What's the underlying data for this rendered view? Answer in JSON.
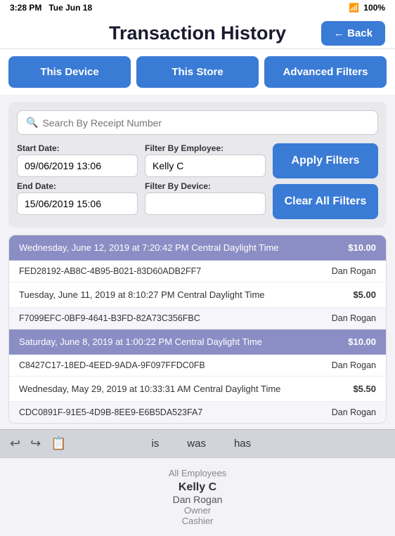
{
  "statusBar": {
    "time": "3:28 PM",
    "date": "Tue Jun 18",
    "wifi": "100%",
    "battery": "100%"
  },
  "header": {
    "backLabel": "← Back",
    "title": "Transaction History"
  },
  "tabs": [
    {
      "id": "this-device",
      "label": "This Device"
    },
    {
      "id": "this-store",
      "label": "This Store"
    },
    {
      "id": "advanced-filters",
      "label": "Advanced Filters"
    }
  ],
  "filters": {
    "searchPlaceholder": "Search By Receipt Number",
    "startDateLabel": "Start Date:",
    "startDateValue": "09/06/2019 13:06",
    "endDateLabel": "End Date:",
    "endDateValue": "15/06/2019 15:06",
    "filterByEmployeeLabel": "Filter By Employee:",
    "filterByEmployeeValue": "Kelly C",
    "filterByDeviceLabel": "Filter By Device:",
    "filterByDeviceValue": "",
    "applyFiltersLabel": "Apply Filters",
    "clearAllFiltersLabel": "Clear All Filters"
  },
  "transactions": [
    {
      "date": "Wednesday, June 12, 2019 at 7:20:42 PM Central Daylight Time",
      "amount": "$10.00",
      "id": "FED28192-AB8C-4B95-B021-83D60ADB2FF7",
      "user": "Dan Rogan",
      "shaded": true
    },
    {
      "date": "Tuesday, June 11, 2019 at 8:10:27 PM Central Daylight Time",
      "amount": "$5.00",
      "id": "F7099EFC-0BF9-4641-B3FD-82A73C356FBC",
      "user": "Dan Rogan",
      "shaded": false
    },
    {
      "date": "Saturday, June 8, 2019 at 1:00:22 PM Central Daylight Time",
      "amount": "$10.00",
      "id": "C8427C17-18ED-4EED-9ADA-9F097FFDC0FB",
      "user": "Dan Rogan",
      "shaded": true
    },
    {
      "date": "Wednesday, May 29, 2019 at 10:33:31 AM Central Daylight Time",
      "amount": "$5.50",
      "id": "CDC0891F-91E5-4D9B-8EE9-E6B5DA523FA7",
      "user": "Dan Rogan",
      "shaded": false
    }
  ],
  "keyboard": {
    "tools": [
      "↩",
      "↩",
      "📋"
    ],
    "words": [
      "is",
      "was",
      "has"
    ]
  },
  "employeeDropdown": {
    "allLabel": "All Employees",
    "employees": [
      {
        "name": "Kelly C",
        "role": ""
      },
      {
        "name": "Dan Rogan",
        "role": "Owner"
      },
      {
        "name": "Cashier",
        "role": ""
      }
    ]
  }
}
